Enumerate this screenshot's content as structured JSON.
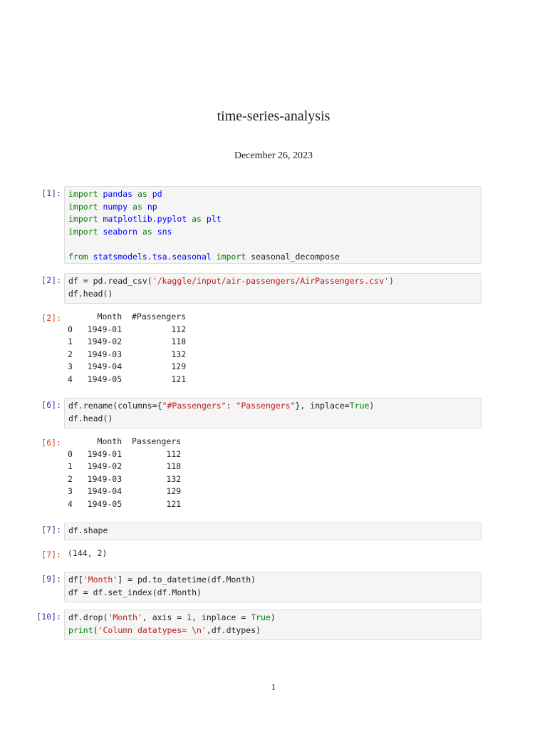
{
  "document": {
    "title": "time-series-analysis",
    "date": "December 26, 2023",
    "page_number": "1"
  },
  "cells": [
    {
      "prompt": "[1]:",
      "lines": [
        [
          [
            "k",
            "import"
          ],
          [
            "t",
            " "
          ],
          [
            "m",
            "pandas"
          ],
          [
            "t",
            " "
          ],
          [
            "k",
            "as"
          ],
          [
            "t",
            " "
          ],
          [
            "m",
            "pd"
          ]
        ],
        [
          [
            "k",
            "import"
          ],
          [
            "t",
            " "
          ],
          [
            "m",
            "numpy"
          ],
          [
            "t",
            " "
          ],
          [
            "k",
            "as"
          ],
          [
            "t",
            " "
          ],
          [
            "m",
            "np"
          ]
        ],
        [
          [
            "k",
            "import"
          ],
          [
            "t",
            " "
          ],
          [
            "m",
            "matplotlib.pyplot"
          ],
          [
            "t",
            " "
          ],
          [
            "k",
            "as"
          ],
          [
            "t",
            " "
          ],
          [
            "m",
            "plt"
          ]
        ],
        [
          [
            "k",
            "import"
          ],
          [
            "t",
            " "
          ],
          [
            "m",
            "seaborn"
          ],
          [
            "t",
            " "
          ],
          [
            "k",
            "as"
          ],
          [
            "t",
            " "
          ],
          [
            "m",
            "sns"
          ]
        ],
        [
          [
            "t",
            " "
          ]
        ],
        [
          [
            "k",
            "from"
          ],
          [
            "t",
            " "
          ],
          [
            "m",
            "statsmodels.tsa.seasonal"
          ],
          [
            "t",
            " "
          ],
          [
            "k",
            "import"
          ],
          [
            "t",
            " seasonal_decompose"
          ]
        ]
      ]
    },
    {
      "prompt": "[2]:",
      "lines": [
        [
          [
            "t",
            "df = pd.read_csv("
          ],
          [
            "s",
            "'/kaggle/input/air-passengers/AirPassengers.csv'"
          ],
          [
            "t",
            ")"
          ]
        ],
        [
          [
            "t",
            "df.head()"
          ]
        ]
      ]
    },
    {
      "prompt": "[6]:",
      "lines": [
        [
          [
            "t",
            "df.rename(columns={"
          ],
          [
            "s",
            "\"#Passengers\""
          ],
          [
            "t",
            ": "
          ],
          [
            "s",
            "\"Passengers\""
          ],
          [
            "t",
            "}, inplace="
          ],
          [
            "n",
            "True"
          ],
          [
            "t",
            ")"
          ]
        ],
        [
          [
            "t",
            "df.head()"
          ]
        ]
      ]
    },
    {
      "prompt": "[7]:",
      "lines": [
        [
          [
            "t",
            "df.shape"
          ]
        ]
      ]
    },
    {
      "prompt": "[9]:",
      "lines": [
        [
          [
            "t",
            "df["
          ],
          [
            "s",
            "'Month'"
          ],
          [
            "t",
            "] = pd.to_datetime(df.Month)"
          ]
        ],
        [
          [
            "t",
            "df = df.set_index(df.Month)"
          ]
        ]
      ]
    },
    {
      "prompt": "[10]:",
      "lines": [
        [
          [
            "t",
            "df.drop("
          ],
          [
            "s",
            "'Month'"
          ],
          [
            "t",
            ", axis = "
          ],
          [
            "n",
            "1"
          ],
          [
            "t",
            ", inplace = "
          ],
          [
            "n",
            "True"
          ],
          [
            "t",
            ")"
          ]
        ],
        [
          [
            "n",
            "print"
          ],
          [
            "t",
            "("
          ],
          [
            "s",
            "'Column datatypes= \\n'"
          ],
          [
            "t",
            ",df.dtypes)"
          ]
        ]
      ]
    }
  ],
  "outputs": [
    {
      "prompt": "[2]:",
      "columns": [
        "",
        "Month",
        "#Passengers"
      ],
      "rows": [
        [
          "0",
          "1949-01",
          "112"
        ],
        [
          "1",
          "1949-02",
          "118"
        ],
        [
          "2",
          "1949-03",
          "132"
        ],
        [
          "3",
          "1949-04",
          "129"
        ],
        [
          "4",
          "1949-05",
          "121"
        ]
      ]
    },
    {
      "prompt": "[6]:",
      "columns": [
        "",
        "Month",
        "Passengers"
      ],
      "rows": [
        [
          "0",
          "1949-01",
          "112"
        ],
        [
          "1",
          "1949-02",
          "118"
        ],
        [
          "2",
          "1949-03",
          "132"
        ],
        [
          "3",
          "1949-04",
          "129"
        ],
        [
          "4",
          "1949-05",
          "121"
        ]
      ]
    },
    {
      "prompt": "[7]:",
      "text": "(144, 2)"
    }
  ]
}
